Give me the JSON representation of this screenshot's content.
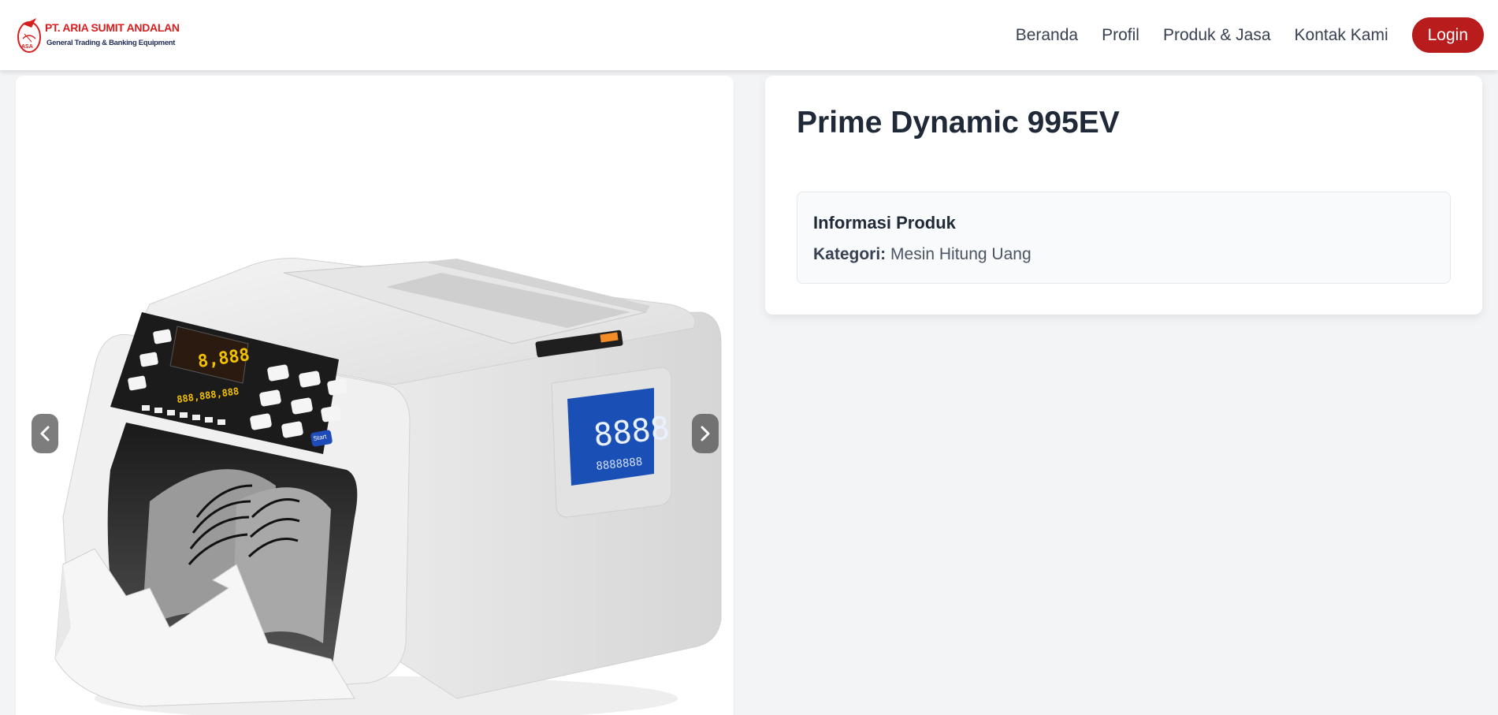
{
  "header": {
    "logo": {
      "name": "PT. ARIA SUMIT ANDALAN",
      "tagline": "General Trading & Banking Equipment",
      "emblem_text": "ASA"
    },
    "nav": [
      {
        "label": "Beranda"
      },
      {
        "label": "Profil"
      },
      {
        "label": "Produk & Jasa"
      },
      {
        "label": "Kontak Kami"
      }
    ],
    "login_label": "Login"
  },
  "gallery": {
    "image_alt": "Prime Dynamic 995EV",
    "prev_icon": "chevron-left-icon",
    "next_icon": "chevron-right-icon",
    "device_display": {
      "main_digits": "8,888",
      "total_digits": "888,888,888",
      "side_digits": "8888",
      "side_small_digits": "8888888",
      "start_key": "Start"
    }
  },
  "product": {
    "title": "Prime Dynamic 995EV",
    "info_heading": "Informasi Produk",
    "category_label": "Kategori:",
    "category_value": "Mesin Hitung Uang"
  },
  "colors": {
    "brand_red": "#b91c1c",
    "text_dark": "#1f2937",
    "page_bg": "#f3f4f6"
  }
}
